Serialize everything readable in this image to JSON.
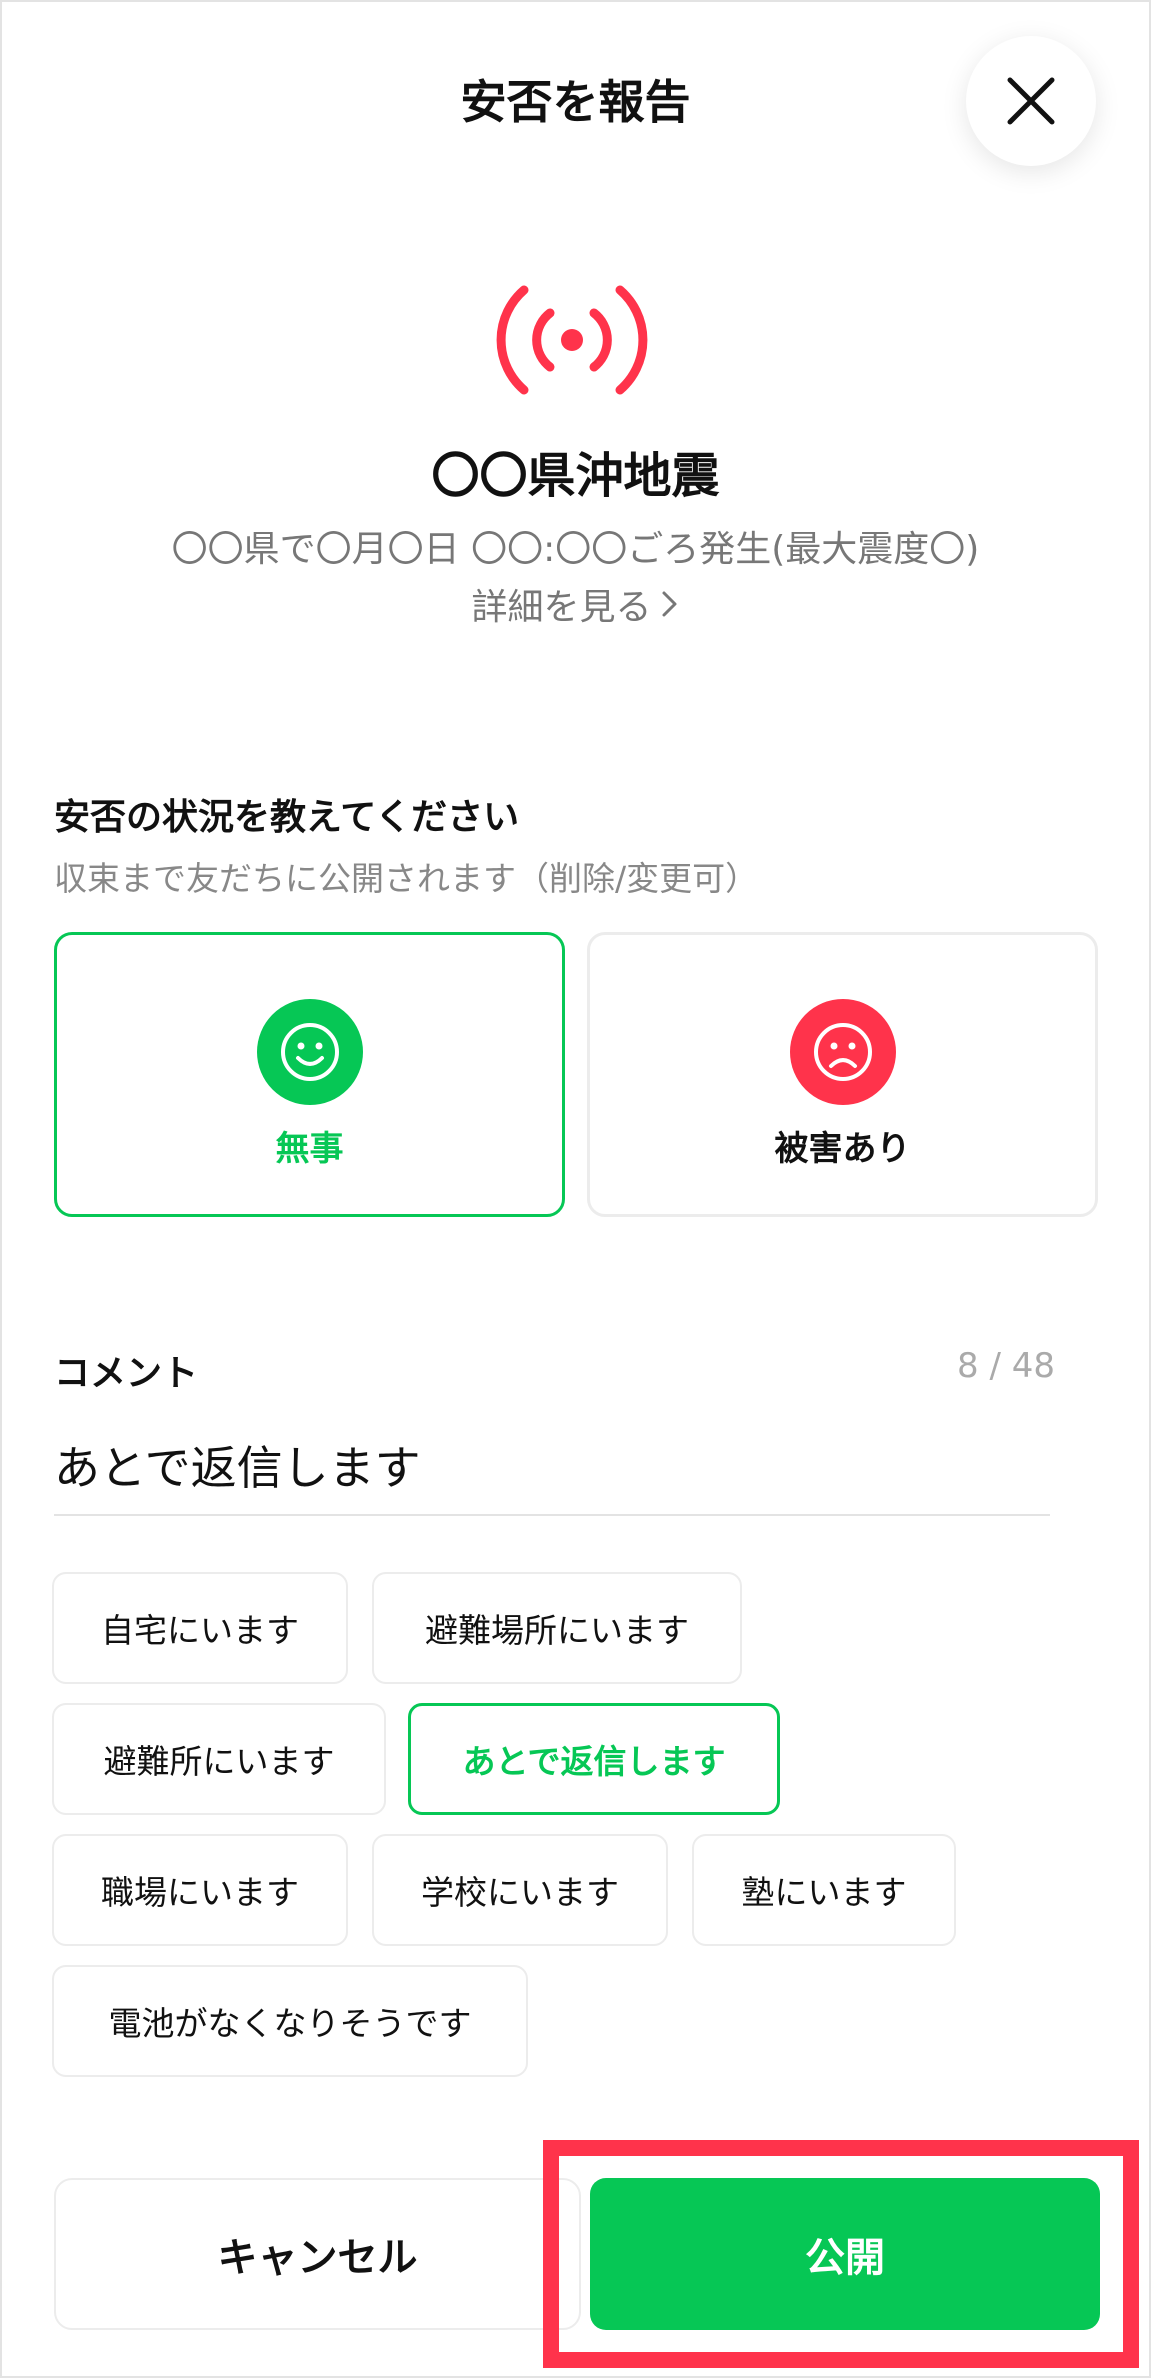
{
  "header": {
    "title": "安否を報告"
  },
  "event": {
    "title": "〇〇県沖地震",
    "info": "〇〇県で〇月〇日 〇〇:〇〇ごろ発生(最大震度〇)",
    "detail_link": "詳細を見る"
  },
  "status": {
    "heading": "安否の状況を教えてください",
    "subtext": "収束まで友だちに公開されます（削除/変更可）",
    "options": [
      {
        "label": "無事",
        "selected": true
      },
      {
        "label": "被害あり",
        "selected": false
      }
    ]
  },
  "comment": {
    "label": "コメント",
    "count": "8 / 48",
    "value": "あとで返信します"
  },
  "suggestions": [
    {
      "label": "自宅にいます",
      "selected": false
    },
    {
      "label": "避難場所にいます",
      "selected": false
    },
    {
      "label": "避難所にいます",
      "selected": false
    },
    {
      "label": "あとで返信します",
      "selected": true
    },
    {
      "label": "職場にいます",
      "selected": false
    },
    {
      "label": "学校にいます",
      "selected": false
    },
    {
      "label": "塾にいます",
      "selected": false
    },
    {
      "label": "電池がなくなりそうです",
      "selected": false
    }
  ],
  "actions": {
    "cancel_label": "キャンセル",
    "publish_label": "公開"
  },
  "colors": {
    "accent_green": "#06c755",
    "alert_red": "#ff334b"
  },
  "icons": {
    "close": "close-icon",
    "alert": "broadcast-alert-icon",
    "safe": "smile-face-icon",
    "damage": "sad-face-icon",
    "detail": "chevron-right-icon"
  }
}
